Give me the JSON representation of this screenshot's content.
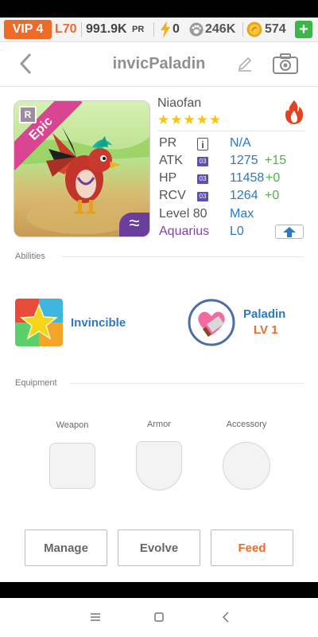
{
  "status_bar": {
    "vip": "VIP 4",
    "level": "L70",
    "pr_value": "991.9K",
    "pr_unit": "PR",
    "energy": "0",
    "paw_currency": "246K",
    "coins": "574",
    "add_label": "+"
  },
  "header": {
    "title": "invicPaladin"
  },
  "monster": {
    "rarity": "Epic",
    "rank_badge": "R",
    "element_symbol": "≈",
    "species": "Niaofan",
    "stars": "★★★★★",
    "stats": [
      {
        "label": "PR",
        "tag": "i",
        "value": "N/A",
        "bonus": ""
      },
      {
        "label": "ATK",
        "tag": "03",
        "value": "1275",
        "bonus": "+15"
      },
      {
        "label": "HP",
        "tag": "03",
        "value": "11458",
        "bonus": "+0"
      },
      {
        "label": "RCV",
        "tag": "03",
        "value": "1264",
        "bonus": "+0"
      }
    ],
    "level_label": "Level 80",
    "level_value": "Max",
    "sign_label": "Aquarius",
    "sign_value": "L0"
  },
  "abilities": {
    "title": "Abilities",
    "items": [
      {
        "name": "Invincible",
        "level": ""
      },
      {
        "name": "Paladin",
        "level": "LV 1"
      }
    ]
  },
  "equipment": {
    "title": "Equipment",
    "slots": [
      "Weapon",
      "Armor",
      "Accessory"
    ]
  },
  "actions": {
    "manage": "Manage",
    "evolve": "Evolve",
    "feed": "Feed"
  },
  "colors": {
    "accent_orange": "#ee6a26",
    "stat_blue": "#2b79c7",
    "bonus_green": "#4fb34c",
    "epic_pink": "#d94590",
    "star_gold": "#f5c511"
  }
}
